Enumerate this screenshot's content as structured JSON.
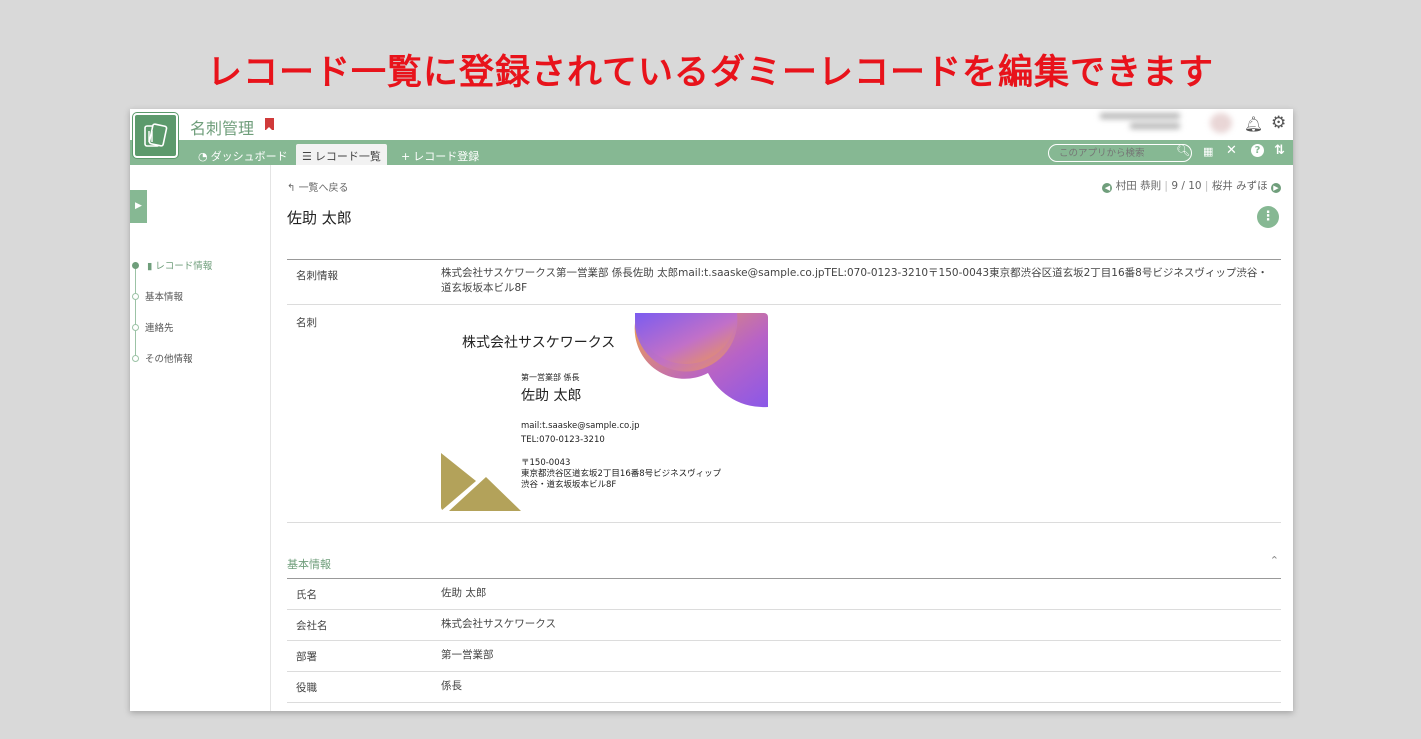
{
  "banner": {
    "text": "レコード一覧に登録されているダミーレコードを編集できます",
    "color": "#e8131b"
  },
  "header": {
    "app_title": "名刺管理",
    "icons": {
      "bookmark": "bookmark-icon",
      "bell": "bell-icon",
      "gear": "gear-icon"
    }
  },
  "nav": {
    "tabs": [
      {
        "label": "ダッシュボード",
        "icon": "dashboard-icon"
      },
      {
        "label": "レコード一覧",
        "icon": "list-icon",
        "active": true
      },
      {
        "label": "レコード登録",
        "icon": "plus-icon"
      }
    ],
    "search_placeholder": "このアプリから検索",
    "icons": [
      "search-icon",
      "qr-icon",
      "tools-icon",
      "help-icon",
      "sync-icon"
    ],
    "accent": "#86b893"
  },
  "sidebar": {
    "items": [
      {
        "label": "レコード情報",
        "active": true
      },
      {
        "label": "基本情報"
      },
      {
        "label": "連絡先"
      },
      {
        "label": "その他情報"
      }
    ]
  },
  "record": {
    "back_label": "一覧へ戻る",
    "prev_user": "村田 恭則",
    "position": "9 / 10",
    "next_user": "桜井 みずほ",
    "title": "佐助 太郎"
  },
  "fields": {
    "card_info_label": "名刺情報",
    "card_info_value": "株式会社サスケワークス第一営業部 係長佐助 太郎mail:t.saaske@sample.co.jpTEL:070-0123-3210〒150-0043東京都渋谷区道玄坂2丁目16番8号ビジネスヴィップ渋谷・道玄坂坂本ビル8F",
    "card_label": "名刺"
  },
  "card": {
    "company": "株式会社サスケワークス",
    "dept": "第一営業部 係長",
    "name": "佐助 太郎",
    "mail": "mail:t.saaske@sample.co.jp",
    "tel": "TEL:070-0123-3210",
    "zip": "〒150-0043",
    "addr1": "東京都渋谷区道玄坂2丁目16番8号ビジネスヴィップ",
    "addr2": "渋谷・道玄坂坂本ビル8F"
  },
  "basic_info": {
    "section_title": "基本情報",
    "rows": [
      {
        "label": "氏名",
        "value": "佐助 太郎"
      },
      {
        "label": "会社名",
        "value": "株式会社サスケワークス"
      },
      {
        "label": "部署",
        "value": "第一営業部"
      },
      {
        "label": "役職",
        "value": "係長"
      }
    ]
  }
}
